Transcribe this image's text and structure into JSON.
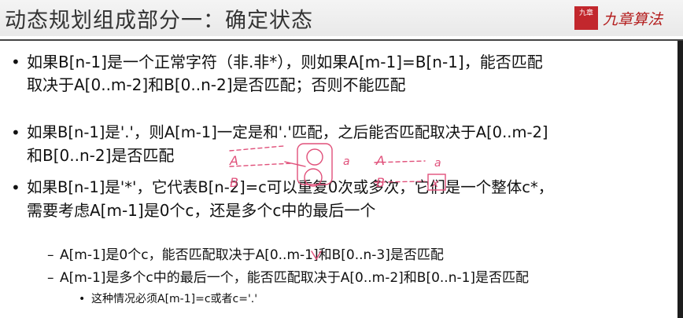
{
  "slide": {
    "title": "动态规划组成部分一：确定状态",
    "logo_seal": "九章",
    "logo_text": "九章算法",
    "bullet_glyph": "•",
    "sub_glyph": "–",
    "b1": {
      "line1": "如果B[n-1]是一个正常字符（非.非*），则如果A[m-1]=B[n-1]，能否匹配",
      "line2": "取决于A[0..m-2]和B[0..n-2]是否匹配；否则不能匹配"
    },
    "b2": {
      "line1": "如果B[n-1]是'.'，则A[m-1]一定是和'.'匹配，之后能否匹配取决于A[0..m-2]",
      "line2": "和B[0..n-2]是否匹配"
    },
    "b3": {
      "line1": "如果B[n-1]是'*'，它代表B[n-2]=c可以重复0次或多次，它们是一个整体c*，",
      "line2": "需要考虑A[m-1]是0个c，还是多个c中的最后一个",
      "sub1": "A[m-1]是0个c，能否匹配取决于A[0..m-1]和B[0..n-3]是否匹配",
      "sub2": "A[m-1]是多个c中的最后一个，能否匹配取决于A[0..m-2]和B[0..n-1]是否匹配",
      "subsub1": "这种情况必须A[m-1]=c或者c='.'"
    },
    "handwriting": {
      "a_left": "A",
      "b_left": "B",
      "a_small": "a",
      "a_right": "A",
      "b_right": "B",
      "a_right_tail": "a",
      "x_mark": "x"
    }
  }
}
